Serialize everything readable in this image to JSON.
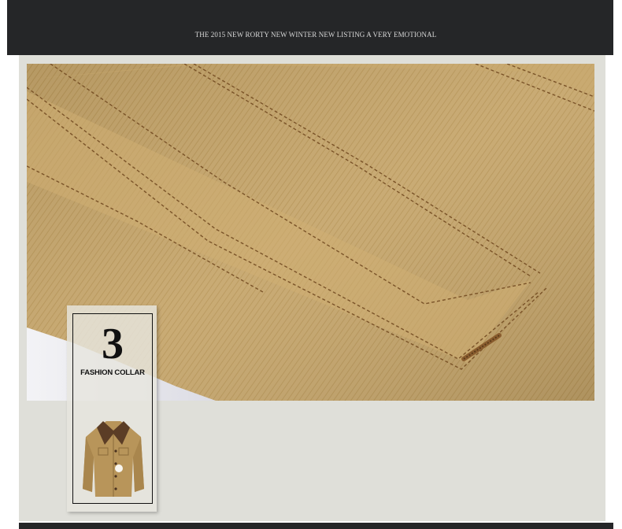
{
  "header": {
    "title": "The 2015 new Rorty new winter new listing  A very emotional"
  },
  "feature": {
    "number": "3",
    "label": "FASHION COLLAR"
  },
  "colors": {
    "header_bg": "#252628",
    "panel_bg": "#dfdfd9",
    "fabric": "#c4a46b",
    "stitch": "#7a5328"
  },
  "images": {
    "main": "khaki-fabric-pocket-flap-closeup",
    "thumbnail": "khaki-jacket-fur-collar"
  }
}
